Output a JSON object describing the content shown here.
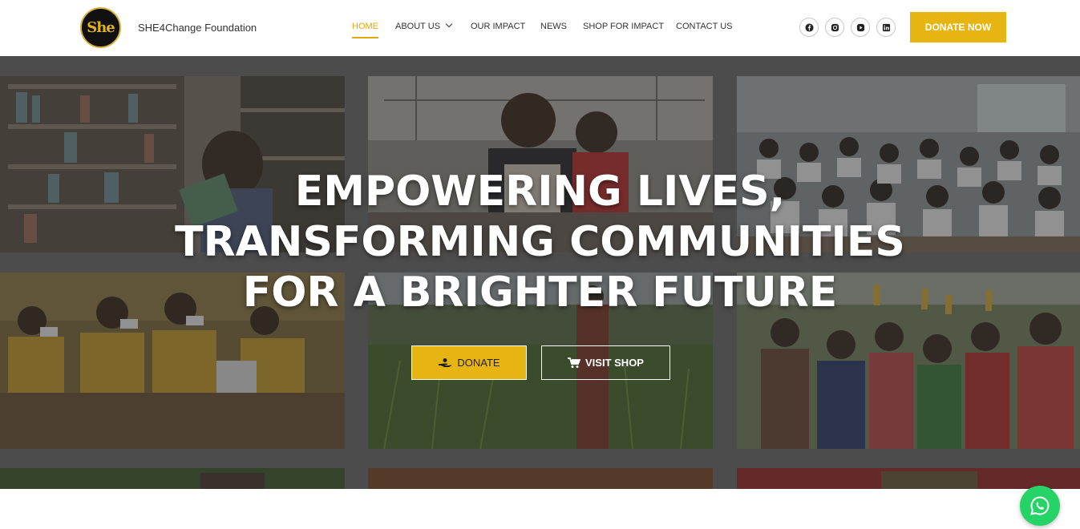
{
  "site": {
    "logo_text": "She",
    "name": "SHE4Change Foundation"
  },
  "nav": {
    "items": [
      {
        "label": "HOME",
        "active": true
      },
      {
        "label": "ABOUT US",
        "has_dropdown": true
      },
      {
        "label": "OUR IMPACT"
      },
      {
        "label": "NEWS"
      },
      {
        "label": "SHOP FOR IMPACT"
      },
      {
        "label": "CONTACT US"
      }
    ]
  },
  "social": [
    {
      "icon": "facebook-icon"
    },
    {
      "icon": "instagram-icon"
    },
    {
      "icon": "youtube-icon"
    },
    {
      "icon": "linkedin-icon"
    }
  ],
  "header": {
    "donate_label": "DONATE NOW"
  },
  "hero": {
    "title_lines": [
      "EMPOWERING LIVES,",
      "TRANSFORMING COMMUNITIES",
      "FOR A BRIGHTER FUTURE"
    ],
    "donate_label": "DONATE",
    "shop_label": "VISIT SHOP"
  },
  "colors": {
    "accent": "#e7b512",
    "nav_active": "#e2a90a",
    "whatsapp": "#25d366"
  }
}
